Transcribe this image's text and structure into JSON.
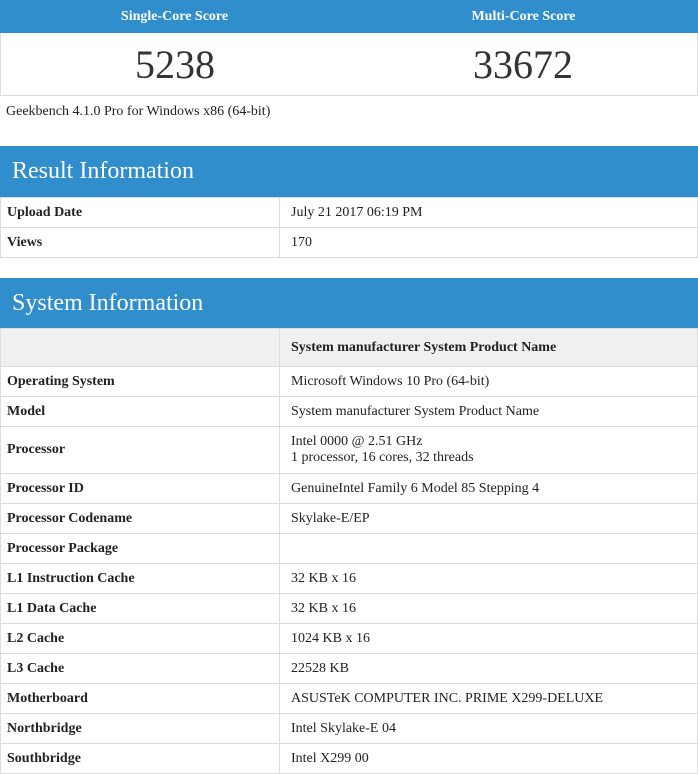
{
  "scores": {
    "single_label": "Single-Core Score",
    "multi_label": "Multi-Core Score",
    "single_value": "5238",
    "multi_value": "33672"
  },
  "version": "Geekbench 4.1.0 Pro for Windows x86 (64-bit)",
  "result_info": {
    "title": "Result Information",
    "rows": [
      {
        "label": "Upload Date",
        "value": "July 21 2017 06:19 PM"
      },
      {
        "label": "Views",
        "value": "170"
      }
    ]
  },
  "system_info": {
    "title": "System Information",
    "header_value": "System manufacturer System Product Name",
    "rows": [
      {
        "label": "Operating System",
        "value": "Microsoft Windows 10 Pro (64-bit)"
      },
      {
        "label": "Model",
        "value": "System manufacturer System Product Name"
      },
      {
        "label": "Processor",
        "value": "Intel 0000 @ 2.51 GHz",
        "value2": "1 processor, 16 cores, 32 threads"
      },
      {
        "label": "Processor ID",
        "value": "GenuineIntel Family 6 Model 85 Stepping 4"
      },
      {
        "label": "Processor Codename",
        "value": "Skylake-E/EP"
      },
      {
        "label": "Processor Package",
        "value": ""
      },
      {
        "label": "L1 Instruction Cache",
        "value": "32 KB x 16"
      },
      {
        "label": "L1 Data Cache",
        "value": "32 KB x 16"
      },
      {
        "label": "L2 Cache",
        "value": "1024 KB x 16"
      },
      {
        "label": "L3 Cache",
        "value": "22528 KB"
      },
      {
        "label": "Motherboard",
        "value": "ASUSTeK COMPUTER INC. PRIME X299-DELUXE"
      },
      {
        "label": "Northbridge",
        "value": "Intel Skylake-E 04"
      },
      {
        "label": "Southbridge",
        "value": "Intel X299 00"
      }
    ]
  },
  "colors": {
    "accent": "#2f8ecb"
  }
}
